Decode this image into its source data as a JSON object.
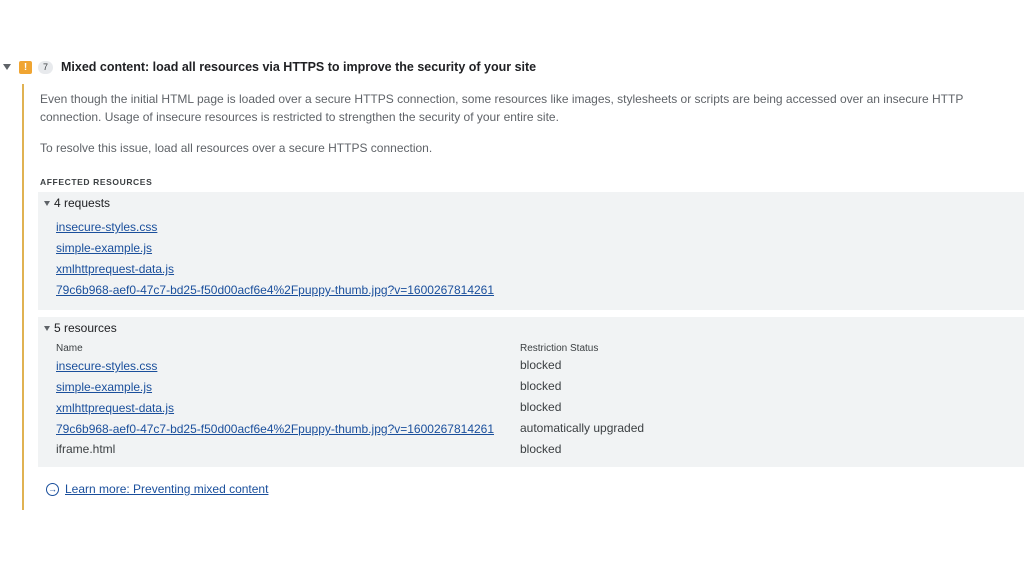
{
  "issue": {
    "count": "7",
    "title": "Mixed content: load all resources via HTTPS to improve the security of your site",
    "description": "Even though the initial HTML page is loaded over a secure HTTPS connection, some resources like images, stylesheets or scripts are being accessed over an insecure HTTP connection. Usage of insecure resources is restricted to strengthen the security of your entire site.",
    "resolve": "To resolve this issue, load all resources over a secure HTTPS connection.",
    "affected_label": "AFFECTED RESOURCES",
    "warning_icon": "!",
    "colors": {
      "accent_border": "#e0b252",
      "warning": "#f0a532",
      "link": "#1a4f9c"
    }
  },
  "requests": {
    "label": "4 requests",
    "items": [
      "insecure-styles.css",
      "simple-example.js",
      "xmlhttprequest-data.js",
      "79c6b968-aef0-47c7-bd25-f50d00acf6e4%2Fpuppy-thumb.jpg?v=1600267814261"
    ]
  },
  "resources": {
    "label": "5 resources",
    "columns": {
      "name": "Name",
      "status": "Restriction Status"
    },
    "rows": [
      {
        "name": "insecure-styles.css",
        "status": "blocked"
      },
      {
        "name": "simple-example.js",
        "status": "blocked"
      },
      {
        "name": "xmlhttprequest-data.js",
        "status": "blocked"
      },
      {
        "name": "79c6b968-aef0-47c7-bd25-f50d00acf6e4%2Fpuppy-thumb.jpg?v=1600267814261",
        "status": "automatically upgraded"
      },
      {
        "name": "iframe.html",
        "status": "blocked"
      }
    ]
  },
  "learn_more": {
    "icon": "→",
    "label": "Learn more: Preventing mixed content"
  }
}
